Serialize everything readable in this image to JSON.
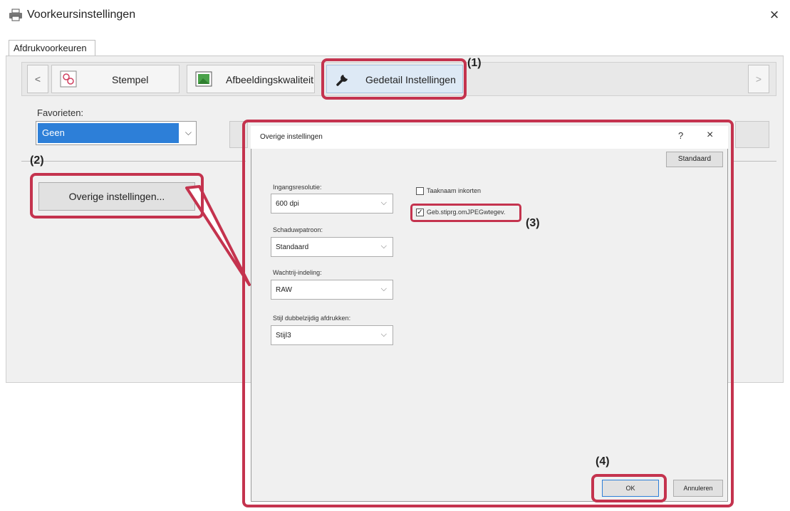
{
  "window": {
    "title": "Voorkeursinstellingen",
    "close_glyph": "×"
  },
  "tabs": [
    {
      "label": "Afdrukvoorkeuren"
    }
  ],
  "carousel": {
    "prev_glyph": "<",
    "next_glyph": ">",
    "features": [
      {
        "label": "Stempel",
        "icon": "stamp-icon"
      },
      {
        "label": "Afbeeldingskwaliteit",
        "icon": "image-quality-icon"
      },
      {
        "label": "Gedetail  Instellingen",
        "icon": "wrench-icon"
      }
    ]
  },
  "favorites": {
    "label": "Favorieten:",
    "value": "Geen",
    "chevron": "⌵"
  },
  "overige_button": "Overige instellingen...",
  "callouts": {
    "c1": "(1)",
    "c2": "(2)",
    "c3": "(3)",
    "c4": "(4)"
  },
  "dialog": {
    "title": "Overige instellingen",
    "help": "?",
    "close": "×",
    "standaard_button": "Standaard",
    "fields": [
      {
        "label": "Ingangsresolutie:",
        "value": "600 dpi"
      },
      {
        "label": "Schaduwpatroon:",
        "value": "Standaard"
      },
      {
        "label": "Wachtrij-indeling:",
        "value": "RAW"
      },
      {
        "label": "Stijl dubbelzijdig afdrukken:",
        "value": "Stijl3"
      }
    ],
    "checkboxes": [
      {
        "label": "Taaknaam inkorten",
        "checked": false
      },
      {
        "label": "Geb.stiprg.omJPEGwtegev.",
        "checked": true
      }
    ],
    "ok_button": "OK",
    "cancel_button": "Annuleren"
  },
  "colors": {
    "highlight": "#c4334e",
    "selection": "#2d7fd8"
  }
}
